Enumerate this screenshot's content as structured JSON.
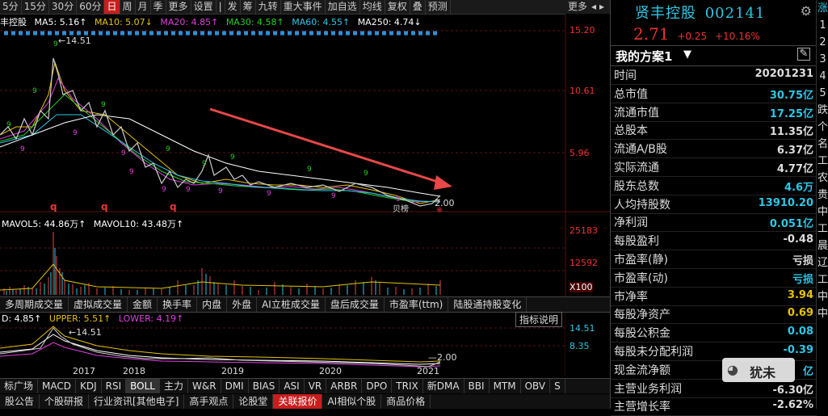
{
  "period_tabs": [
    {
      "label": "5分"
    },
    {
      "label": "15分"
    },
    {
      "label": "30分"
    },
    {
      "label": "60分"
    },
    {
      "label": "日",
      "active": true
    },
    {
      "label": "周"
    },
    {
      "label": "月"
    },
    {
      "label": "季"
    },
    {
      "label": "更多"
    },
    {
      "label": "设置"
    },
    {
      "label": "|"
    },
    {
      "label": "发"
    },
    {
      "label": "筹"
    },
    {
      "label": "九转"
    },
    {
      "label": "重大事件"
    },
    {
      "label": "加自选"
    },
    {
      "label": "均线"
    },
    {
      "label": "复权"
    },
    {
      "label": "叠"
    },
    {
      "label": "预测"
    },
    {
      "label": "更多"
    }
  ],
  "ma_header": {
    "name": "丰控股",
    "ma5": "MA5: 5.16↑",
    "ma10": "MA10: 5.07↓",
    "ma20": "MA20: 4.85↑",
    "ma30": "MA30: 4.58↑",
    "ma60": "MA60: 4.55↑",
    "ma250": "MA250: 4.74↓"
  },
  "price_axis": [
    "15.20",
    "10.61",
    "5.96"
  ],
  "price_marks": {
    "high": "14.51",
    "low": "2.00",
    "q_labels": [
      "q",
      "q",
      "q"
    ],
    "b_label": "贝榜",
    "x_label": "※"
  },
  "vol_header": {
    "ma5": "MAVOL5: 44.86万↑",
    "ma10": "MAVOL10: 43.48万↑"
  },
  "vol_axis": [
    "25183",
    "12592",
    "X100"
  ],
  "indicator_tabs": [
    "多周期成交量",
    "虚拟成交量",
    "金额",
    "换手率",
    "内盘",
    "外盘",
    "AI立桩成交量",
    "盘后成交量",
    "市盈率(ttm)",
    "陆股通持股变化"
  ],
  "boll_header": {
    "mid": "D: 4.85↑",
    "upper": "UPPER: 5.51↑",
    "lower": "LOWER: 4.19↑",
    "button": "指标说明"
  },
  "boll_axis": [
    "14.51",
    "8.35"
  ],
  "boll_marks": {
    "high": "14.51",
    "low": "2.00"
  },
  "years": [
    "2017",
    "2018",
    "2019",
    "2020",
    "2021"
  ],
  "bottom_tabs": [
    {
      "label": "标广场"
    },
    {
      "label": "MACD"
    },
    {
      "label": "KDJ"
    },
    {
      "label": "RSI"
    },
    {
      "label": "BOLL",
      "active": true
    },
    {
      "label": "主力"
    },
    {
      "label": "W&R"
    },
    {
      "label": "DMI"
    },
    {
      "label": "BIAS"
    },
    {
      "label": "ASI"
    },
    {
      "label": "VR"
    },
    {
      "label": "ARBR"
    },
    {
      "label": "DPO"
    },
    {
      "label": "TRIX"
    },
    {
      "label": "新DMA"
    },
    {
      "label": "BBI"
    },
    {
      "label": "MTM"
    },
    {
      "label": "OBV"
    },
    {
      "label": "S"
    }
  ],
  "info_tabs": [
    {
      "label": "股公告"
    },
    {
      "label": "个股研报"
    },
    {
      "label": "行业资讯[其他电子]"
    },
    {
      "label": "高手观点"
    },
    {
      "label": "论股堂"
    },
    {
      "label": "关联报价",
      "active": true
    },
    {
      "label": "AI相似个股"
    },
    {
      "label": "商品价格"
    }
  ],
  "stock": {
    "name": "贤丰控股",
    "code": "002141",
    "price": "2.71",
    "change": "+0.25",
    "change_pct": "+10.16%"
  },
  "scheme": {
    "title": "我的方案1",
    "arrow": "▼"
  },
  "fundamentals": [
    {
      "k": "时间",
      "v": "20201231",
      "c": "#ddd"
    },
    {
      "k": "总市值",
      "v": "30.75亿",
      "c": "#2ec7e6"
    },
    {
      "k": "流通市值",
      "v": "17.25亿",
      "c": "#2ec7e6"
    },
    {
      "k": "总股本",
      "v": "11.35亿",
      "c": "#ddd"
    },
    {
      "k": "流通A/B股",
      "v": "6.37亿",
      "c": "#ddd"
    },
    {
      "k": "实际流通",
      "v": "4.77亿",
      "c": "#ddd"
    },
    {
      "k": "股东总数",
      "v": "4.6万",
      "c": "#2ec7e6"
    },
    {
      "k": "人均持股数",
      "v": "13910.20",
      "c": "#2ec7e6"
    },
    {
      "k": "净利润",
      "v": "0.051亿",
      "c": "#2ec7e6"
    },
    {
      "k": "每股盈利",
      "v": "-0.48",
      "c": "#ddd"
    },
    {
      "k": "市盈率(静)",
      "v": "亏损",
      "c": "#ddd"
    },
    {
      "k": "市盈率(动)",
      "v": "亏损",
      "c": "#2ec7e6"
    },
    {
      "k": "市净率",
      "v": "3.94",
      "c": "#e5c300"
    },
    {
      "k": "每股净资产",
      "v": "0.69",
      "c": "#e5c300"
    },
    {
      "k": "每股公积金",
      "v": "0.08",
      "c": "#2ec7e6"
    },
    {
      "k": "每股未分配利润",
      "v": "-0.39",
      "c": "#2ec7e6"
    },
    {
      "k": "现金流净额",
      "v": "亿",
      "c": "#2ec7e6"
    },
    {
      "k": "主营业务利润",
      "v": "-6.30亿",
      "c": "#ddd"
    },
    {
      "k": "主营增长率",
      "v": "-2.62%",
      "c": "#ddd"
    }
  ],
  "watermark": "犹未",
  "edge_chars": [
    "涨",
    "1",
    "2",
    "3",
    "4",
    "5",
    "跌",
    "个",
    "名",
    "工",
    "农",
    "贵",
    "中",
    "工",
    "晨",
    "辽",
    "工",
    "中",
    "中"
  ]
}
